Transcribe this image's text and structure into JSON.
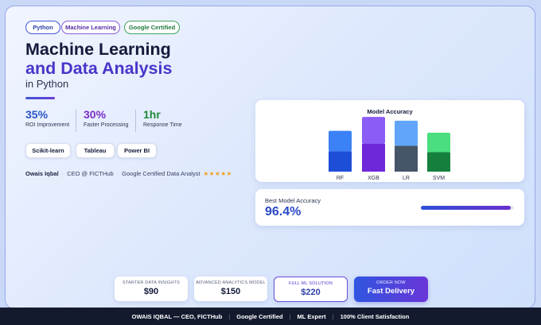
{
  "tags": [
    "Python",
    "Machine Learning",
    "Google Certified"
  ],
  "hero": {
    "title_line1": "Machine Learning",
    "title_line2": "and Data Analysis",
    "subtitle": "in Python"
  },
  "metrics": [
    {
      "value": "35%",
      "label": "ROI Improvement",
      "color": "#2b56c8"
    },
    {
      "value": "30%",
      "label": "Faster Processing",
      "color": "#7a2fc4"
    },
    {
      "value": "1hr",
      "label": "Response Time",
      "color": "#1f8a3c"
    }
  ],
  "tools": [
    "Scikit-learn",
    "Tableau",
    "Power BI"
  ],
  "byline": {
    "name": "Owais Iqbal",
    "role": "CEO @ FICTHub",
    "credential": "Google Certified Data Analyst",
    "stars": "★★★★★"
  },
  "chart_data": {
    "type": "bar",
    "title": "Model Accuracy",
    "categories": [
      "RF",
      "XGB",
      "LR",
      "SVM"
    ],
    "series": [
      {
        "values": [
          0.44,
          0.6,
          0.56,
          0.42
        ]
      },
      {
        "values": [
          0.44,
          0.58,
          0.54,
          0.42
        ]
      }
    ],
    "colors": {
      "top": [
        "#3b82f6",
        "#8b5cf6",
        "#60a5fa",
        "#4ade80"
      ],
      "bottom": [
        "#1d4ed8",
        "#6d28d9",
        "#475569",
        "#15803d"
      ]
    },
    "grid": false
  },
  "best_accuracy": {
    "label": "Best Model Accuracy",
    "value": "96.4%",
    "progress": 0.964
  },
  "pricing": [
    {
      "label": "STARTER DATA INSIGHTS",
      "price": "$90"
    },
    {
      "label": "ADVANCED ANALYTICS MODEL",
      "price": "$150"
    },
    {
      "label": "FULL ML SOLUTION",
      "price": "$220"
    }
  ],
  "order": {
    "label": "ORDER NOW",
    "value": "Fast Delivery"
  },
  "footer": [
    "OWAIS IQBAL — CEO, FICTHub",
    "Google Certified",
    "ML Expert",
    "100% Client Satisfaction"
  ]
}
